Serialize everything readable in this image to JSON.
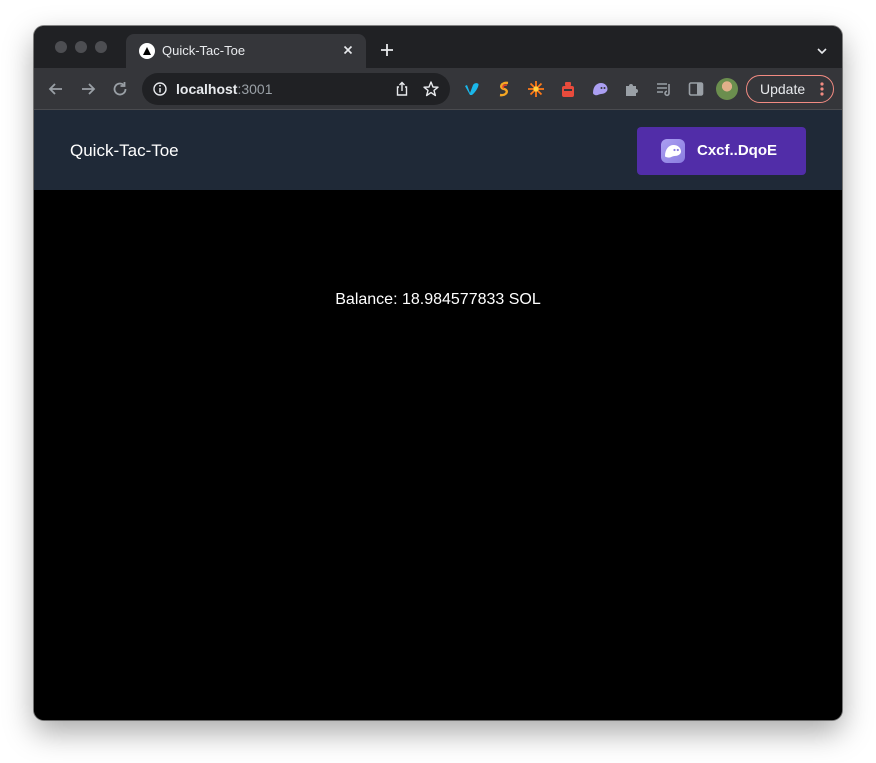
{
  "browser": {
    "tab": {
      "title": "Quick-Tac-Toe",
      "favicon": "nextjs-triangle-icon"
    },
    "omnibox": {
      "host": "localhost",
      "port": ":3001"
    },
    "update_label": "Update",
    "extensions": [
      "vimeo-icon",
      "swap-icon",
      "spark-icon",
      "gas-pump-icon",
      "phantom-icon",
      "puzzle-icon",
      "reading-list-icon",
      "side-panel-icon"
    ]
  },
  "app": {
    "title": "Quick-Tac-Toe",
    "wallet": {
      "label": "Cxcf..DqoE",
      "icon": "phantom-icon",
      "color": "#512da8"
    },
    "balance_text": "Balance: 18.984577833 SOL"
  },
  "colors": {
    "header_bg": "#1f2937",
    "page_bg": "#000000",
    "update_border": "#f28b82"
  }
}
